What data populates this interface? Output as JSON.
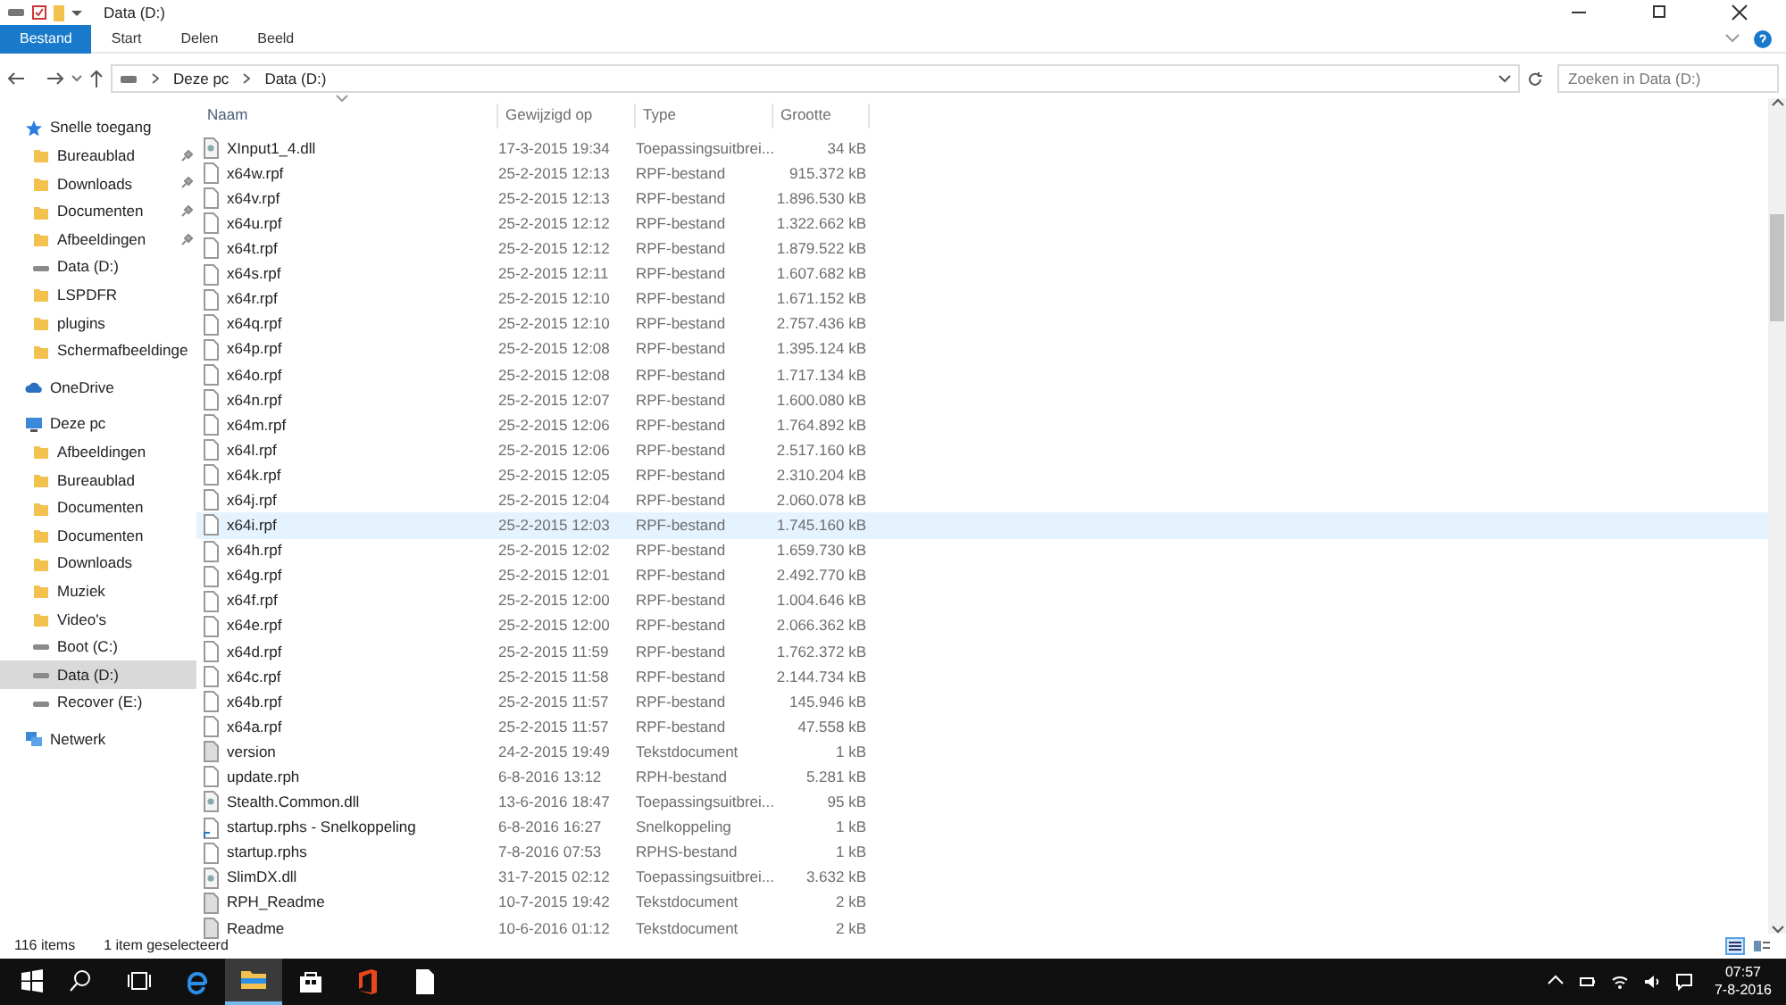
{
  "window": {
    "title": "Data (D:)"
  },
  "ribbon_tabs": [
    {
      "label": "Bestand",
      "selected": true
    },
    {
      "label": "Start",
      "selected": false
    },
    {
      "label": "Delen",
      "selected": false
    },
    {
      "label": "Beeld",
      "selected": false
    }
  ],
  "address": {
    "crumbs": [
      "Deze pc",
      "Data (D:)"
    ]
  },
  "search": {
    "placeholder": "Zoeken in Data (D:)"
  },
  "sidebar": {
    "items": [
      {
        "label": "Snelle toegang",
        "kind": "star",
        "pinned": false,
        "selected": false
      },
      {
        "label": "Bureaublad",
        "kind": "folder",
        "pinned": true,
        "selected": false
      },
      {
        "label": "Downloads",
        "kind": "folder",
        "pinned": true,
        "selected": false
      },
      {
        "label": "Documenten",
        "kind": "folder",
        "pinned": true,
        "selected": false
      },
      {
        "label": "Afbeeldingen",
        "kind": "folder",
        "pinned": true,
        "selected": false
      },
      {
        "label": "Data (D:)",
        "kind": "drive",
        "pinned": false,
        "selected": false
      },
      {
        "label": "LSPDFR",
        "kind": "folder",
        "pinned": false,
        "selected": false
      },
      {
        "label": "plugins",
        "kind": "folder",
        "pinned": false,
        "selected": false
      },
      {
        "label": "Schermafbeeldinge",
        "kind": "folder",
        "pinned": false,
        "selected": false
      },
      {
        "label": "OneDrive",
        "kind": "cloud",
        "pinned": false,
        "selected": false
      },
      {
        "label": "Deze pc",
        "kind": "pc",
        "pinned": false,
        "selected": false
      },
      {
        "label": "Afbeeldingen",
        "kind": "folder",
        "pinned": false,
        "selected": false
      },
      {
        "label": "Bureaublad",
        "kind": "folder",
        "pinned": false,
        "selected": false
      },
      {
        "label": "Documenten",
        "kind": "folder",
        "pinned": false,
        "selected": false
      },
      {
        "label": "Documenten",
        "kind": "folder",
        "pinned": false,
        "selected": false
      },
      {
        "label": "Downloads",
        "kind": "folder",
        "pinned": false,
        "selected": false
      },
      {
        "label": "Muziek",
        "kind": "folder",
        "pinned": false,
        "selected": false
      },
      {
        "label": "Video's",
        "kind": "folder",
        "pinned": false,
        "selected": false
      },
      {
        "label": "Boot (C:)",
        "kind": "drive",
        "pinned": false,
        "selected": false
      },
      {
        "label": "Data (D:)",
        "kind": "drive",
        "pinned": false,
        "selected": true
      },
      {
        "label": "Recover (E:)",
        "kind": "drive",
        "pinned": false,
        "selected": false
      },
      {
        "label": "Netwerk",
        "kind": "network",
        "pinned": false,
        "selected": false
      }
    ]
  },
  "table": {
    "columns": [
      "Naam",
      "Gewijzigd op",
      "Type",
      "Grootte"
    ],
    "rows": [
      {
        "name": "XInput1_4.dll",
        "modified": "17-3-2015 19:34",
        "type": "Toepassingsuitbrei...",
        "size": "34 kB",
        "kind": "dll",
        "selected": false
      },
      {
        "name": "x64w.rpf",
        "modified": "25-2-2015 12:13",
        "type": "RPF-bestand",
        "size": "915.372 kB",
        "kind": "file",
        "selected": false
      },
      {
        "name": "x64v.rpf",
        "modified": "25-2-2015 12:13",
        "type": "RPF-bestand",
        "size": "1.896.530 kB",
        "kind": "file",
        "selected": false
      },
      {
        "name": "x64u.rpf",
        "modified": "25-2-2015 12:12",
        "type": "RPF-bestand",
        "size": "1.322.662 kB",
        "kind": "file",
        "selected": false
      },
      {
        "name": "x64t.rpf",
        "modified": "25-2-2015 12:12",
        "type": "RPF-bestand",
        "size": "1.879.522 kB",
        "kind": "file",
        "selected": false
      },
      {
        "name": "x64s.rpf",
        "modified": "25-2-2015 12:11",
        "type": "RPF-bestand",
        "size": "1.607.682 kB",
        "kind": "file",
        "selected": false
      },
      {
        "name": "x64r.rpf",
        "modified": "25-2-2015 12:10",
        "type": "RPF-bestand",
        "size": "1.671.152 kB",
        "kind": "file",
        "selected": false
      },
      {
        "name": "x64q.rpf",
        "modified": "25-2-2015 12:10",
        "type": "RPF-bestand",
        "size": "2.757.436 kB",
        "kind": "file",
        "selected": false
      },
      {
        "name": "x64p.rpf",
        "modified": "25-2-2015 12:08",
        "type": "RPF-bestand",
        "size": "1.395.124 kB",
        "kind": "file",
        "selected": false
      },
      {
        "name": "x64o.rpf",
        "modified": "25-2-2015 12:08",
        "type": "RPF-bestand",
        "size": "1.717.134 kB",
        "kind": "file",
        "selected": false
      },
      {
        "name": "x64n.rpf",
        "modified": "25-2-2015 12:07",
        "type": "RPF-bestand",
        "size": "1.600.080 kB",
        "kind": "file",
        "selected": false
      },
      {
        "name": "x64m.rpf",
        "modified": "25-2-2015 12:06",
        "type": "RPF-bestand",
        "size": "1.764.892 kB",
        "kind": "file",
        "selected": false
      },
      {
        "name": "x64l.rpf",
        "modified": "25-2-2015 12:06",
        "type": "RPF-bestand",
        "size": "2.517.160 kB",
        "kind": "file",
        "selected": false
      },
      {
        "name": "x64k.rpf",
        "modified": "25-2-2015 12:05",
        "type": "RPF-bestand",
        "size": "2.310.204 kB",
        "kind": "file",
        "selected": false
      },
      {
        "name": "x64j.rpf",
        "modified": "25-2-2015 12:04",
        "type": "RPF-bestand",
        "size": "2.060.078 kB",
        "kind": "file",
        "selected": false
      },
      {
        "name": "x64i.rpf",
        "modified": "25-2-2015 12:03",
        "type": "RPF-bestand",
        "size": "1.745.160 kB",
        "kind": "file",
        "selected": true
      },
      {
        "name": "x64h.rpf",
        "modified": "25-2-2015 12:02",
        "type": "RPF-bestand",
        "size": "1.659.730 kB",
        "kind": "file",
        "selected": false
      },
      {
        "name": "x64g.rpf",
        "modified": "25-2-2015 12:01",
        "type": "RPF-bestand",
        "size": "2.492.770 kB",
        "kind": "file",
        "selected": false
      },
      {
        "name": "x64f.rpf",
        "modified": "25-2-2015 12:00",
        "type": "RPF-bestand",
        "size": "1.004.646 kB",
        "kind": "file",
        "selected": false
      },
      {
        "name": "x64e.rpf",
        "modified": "25-2-2015 12:00",
        "type": "RPF-bestand",
        "size": "2.066.362 kB",
        "kind": "file",
        "selected": false
      },
      {
        "name": "x64d.rpf",
        "modified": "25-2-2015 11:59",
        "type": "RPF-bestand",
        "size": "1.762.372 kB",
        "kind": "file",
        "selected": false
      },
      {
        "name": "x64c.rpf",
        "modified": "25-2-2015 11:58",
        "type": "RPF-bestand",
        "size": "2.144.734 kB",
        "kind": "file",
        "selected": false
      },
      {
        "name": "x64b.rpf",
        "modified": "25-2-2015 11:57",
        "type": "RPF-bestand",
        "size": "145.946 kB",
        "kind": "file",
        "selected": false
      },
      {
        "name": "x64a.rpf",
        "modified": "25-2-2015 11:57",
        "type": "RPF-bestand",
        "size": "47.558 kB",
        "kind": "file",
        "selected": false
      },
      {
        "name": "version",
        "modified": "24-2-2015 19:49",
        "type": "Tekstdocument",
        "size": "1 kB",
        "kind": "text",
        "selected": false
      },
      {
        "name": "update.rph",
        "modified": "6-8-2016 13:12",
        "type": "RPH-bestand",
        "size": "5.281 kB",
        "kind": "file",
        "selected": false
      },
      {
        "name": "Stealth.Common.dll",
        "modified": "13-6-2016 18:47",
        "type": "Toepassingsuitbrei...",
        "size": "95 kB",
        "kind": "dll",
        "selected": false
      },
      {
        "name": "startup.rphs - Snelkoppeling",
        "modified": "6-8-2016 16:27",
        "type": "Snelkoppeling",
        "size": "1 kB",
        "kind": "shortcut",
        "selected": false
      },
      {
        "name": "startup.rphs",
        "modified": "7-8-2016 07:53",
        "type": "RPHS-bestand",
        "size": "1 kB",
        "kind": "file",
        "selected": false
      },
      {
        "name": "SlimDX.dll",
        "modified": "31-7-2015 02:12",
        "type": "Toepassingsuitbrei...",
        "size": "3.632 kB",
        "kind": "dll",
        "selected": false
      },
      {
        "name": "RPH_Readme",
        "modified": "10-7-2015 19:42",
        "type": "Tekstdocument",
        "size": "2 kB",
        "kind": "text",
        "selected": false
      },
      {
        "name": "Readme",
        "modified": "10-6-2016 01:12",
        "type": "Tekstdocument",
        "size": "2 kB",
        "kind": "text",
        "selected": false
      }
    ]
  },
  "status_bar": {
    "count": "116 items",
    "selection": "1 item geselecteerd"
  },
  "taskbar": {
    "time": "07:57",
    "date": "7-8-2016"
  }
}
